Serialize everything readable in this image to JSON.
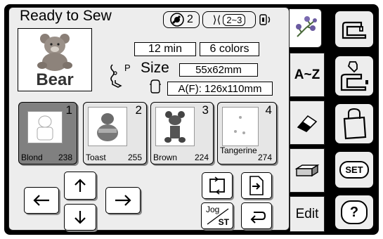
{
  "header": {
    "title": "Ready to Sew",
    "needle_count": "2",
    "thread_range": "2~3"
  },
  "design": {
    "name": "Bear",
    "time": "12 min",
    "colors": "6 colors",
    "size_label": "Size",
    "size_value": "55x62mm",
    "hoop_value": "A(F): 126x110mm",
    "presser_label": "P"
  },
  "thread_cards": [
    {
      "index": "1",
      "name": "Blond",
      "code": "238",
      "selected": true
    },
    {
      "index": "2",
      "name": "Toast",
      "code": "255",
      "selected": false
    },
    {
      "index": "3",
      "name": "Brown",
      "code": "224",
      "selected": false
    },
    {
      "index": "4",
      "name": "Tangerine",
      "code": "274",
      "selected": false
    }
  ],
  "controls": {
    "jog_label": "Jog",
    "st_label": "ST"
  },
  "side_tabs": {
    "alpha_label": "A~Z",
    "edit_label": "Edit"
  },
  "right_buttons": {
    "set_label": "SET",
    "help_label": "?"
  }
}
